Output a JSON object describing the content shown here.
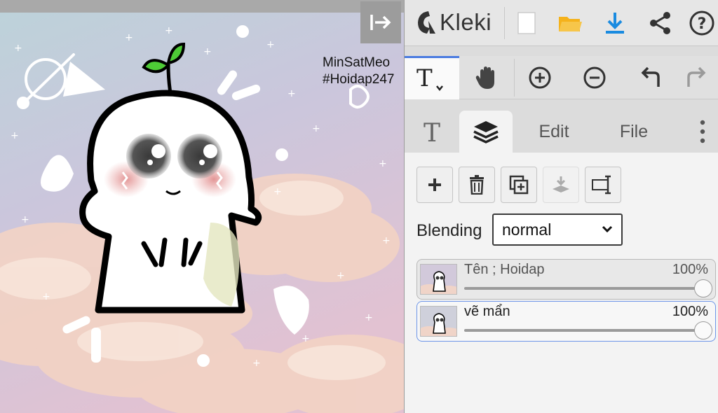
{
  "app": {
    "name": "Kleki"
  },
  "canvas": {
    "watermark_lines": [
      "MinSatMeo",
      "#Hoidap247"
    ]
  },
  "panel": {
    "tabs": [
      {
        "label": "",
        "icon": "text-icon"
      },
      {
        "label": "",
        "icon": "layers-icon"
      },
      {
        "label": "Edit"
      },
      {
        "label": "File"
      }
    ],
    "layers": {
      "blending_label": "Blending",
      "blending_value": "normal",
      "items": [
        {
          "name": "Tên ; Hoidap",
          "opacity": "100%",
          "opacity_fraction": 1.0,
          "active": false
        },
        {
          "name": "vẽ mẩn",
          "opacity": "100%",
          "opacity_fraction": 1.0,
          "active": true
        }
      ]
    }
  },
  "colors": {
    "accent": "#4a7be0",
    "download": "#1a8be0",
    "folder": "#f5b21b",
    "panel_bg": "#dcdcdc"
  }
}
